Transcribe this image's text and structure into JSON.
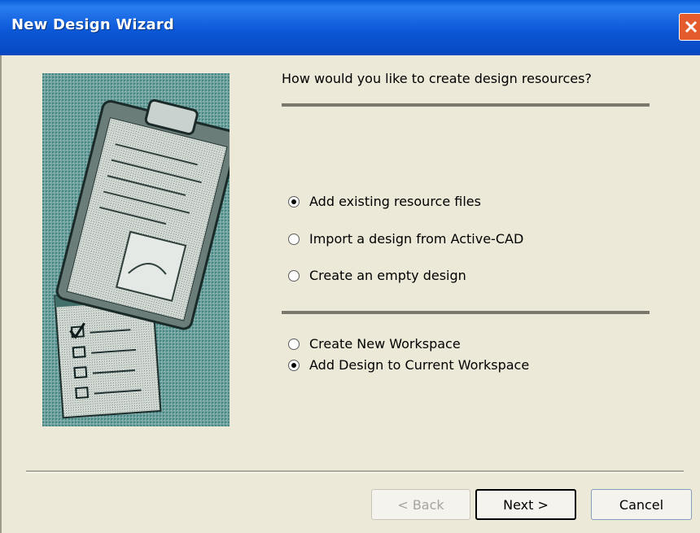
{
  "window": {
    "title": "New Design Wizard"
  },
  "question": "How would you like to create design resources?",
  "source_options": [
    {
      "label": "Add existing resource files",
      "checked": true
    },
    {
      "label": "Import a design from Active-CAD",
      "checked": false
    },
    {
      "label": "Create an empty design",
      "checked": false
    }
  ],
  "workspace_options": [
    {
      "label": "Create New Workspace",
      "checked": false
    },
    {
      "label": "Add Design to Current Workspace",
      "checked": true
    }
  ],
  "buttons": {
    "back": "< Back",
    "next": "Next >",
    "cancel": "Cancel"
  },
  "colors": {
    "titlebar": "#0b58d8",
    "dialog_bg": "#ece9d8",
    "close": "#e45c2e"
  }
}
